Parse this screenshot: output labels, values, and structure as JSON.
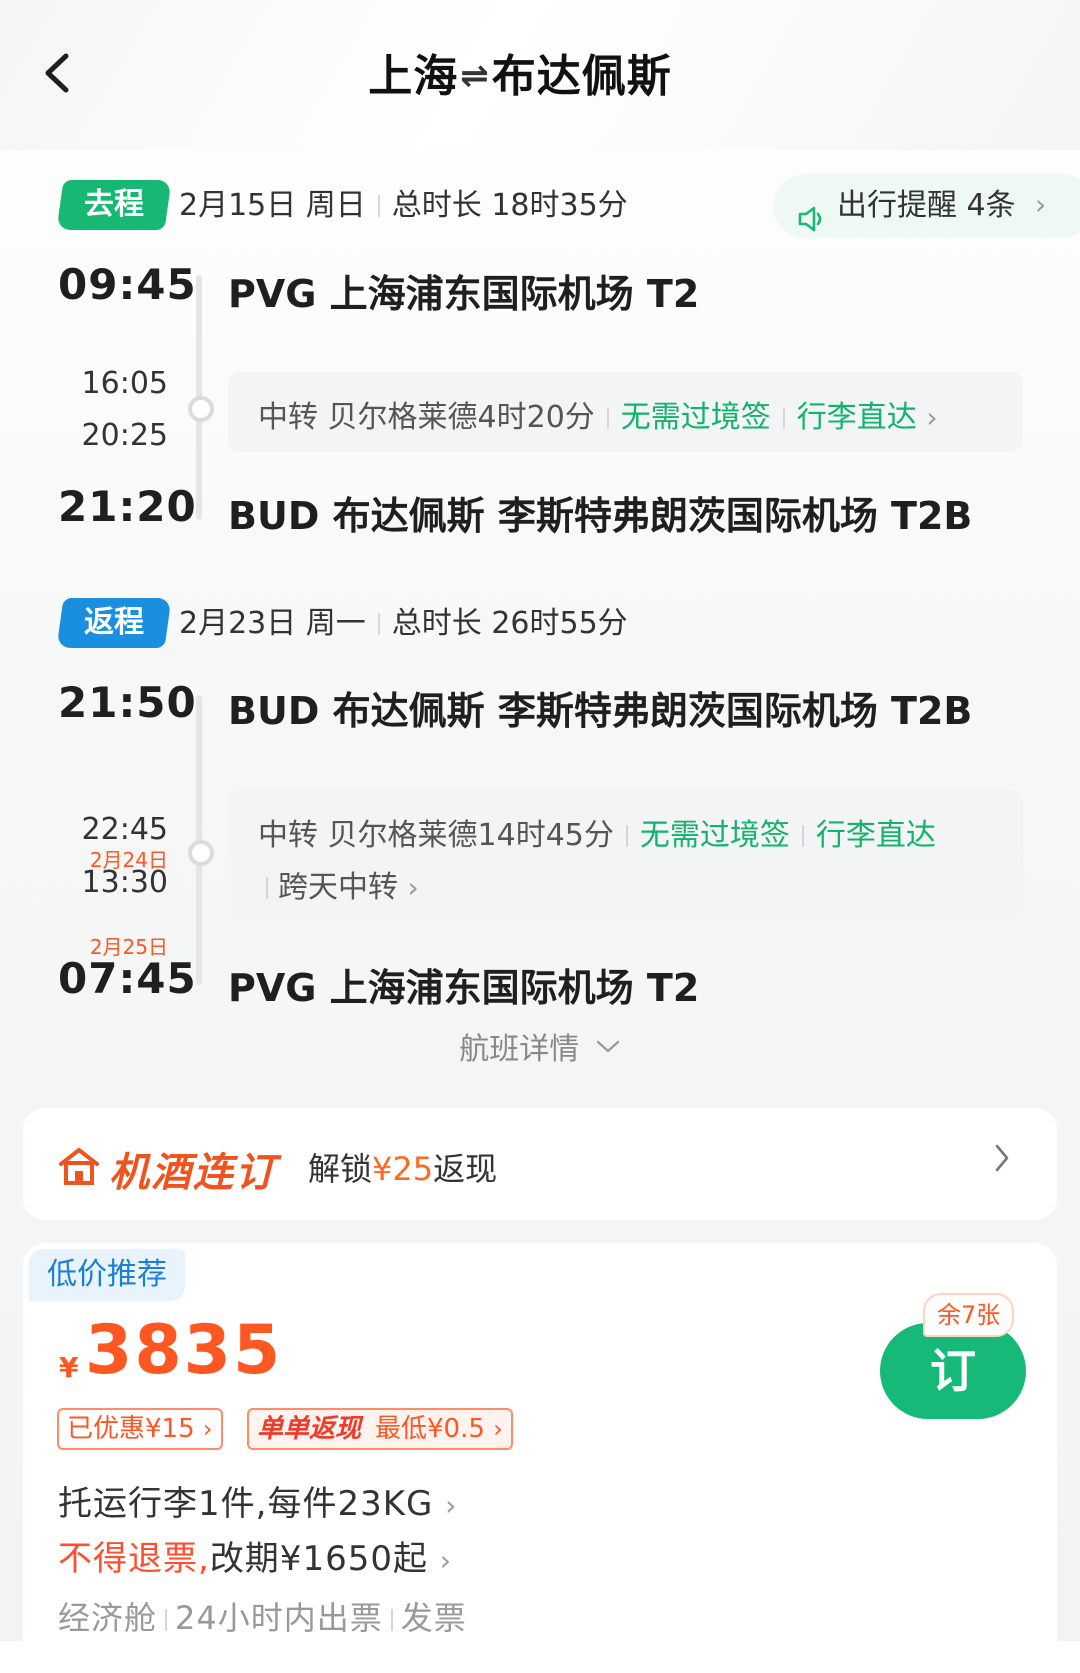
{
  "header": {
    "from_city": "上海",
    "arrows": "⇌",
    "to_city": "布达佩斯",
    "back_icon": "chevron-left-icon"
  },
  "outbound": {
    "tag": "去程",
    "date": "2月15日 周日",
    "duration": "总时长 18时35分",
    "reminder": "出行提醒 4条",
    "dep_time": "09:45",
    "dep_airport": "PVG 上海浦东国际机场 T2",
    "transfer_arrive": "16:05",
    "transfer_depart": "20:25",
    "transfer_text": "中转 贝尔格莱德4时20分",
    "no_visa": "无需过境签",
    "baggage_through": "行李直达",
    "arr_time": "21:20",
    "arr_airport": "BUD 布达佩斯 李斯特弗朗茨国际机场 T2B"
  },
  "return": {
    "tag": "返程",
    "date": "2月23日 周一",
    "duration": "总时长 26时55分",
    "dep_time": "21:50",
    "dep_airport": "BUD 布达佩斯 李斯特弗朗茨国际机场 T2B",
    "transfer_arrive": "22:45",
    "transfer_date": "2月24日",
    "transfer_depart": "13:30",
    "transfer_text": "中转 贝尔格莱德14时45分",
    "no_visa": "无需过境签",
    "baggage_through": "行李直达",
    "overnight": "跨天中转",
    "arr_date": "2月25日",
    "arr_time": "07:45",
    "arr_airport": "PVG 上海浦东国际机场 T2"
  },
  "flight_detail": "航班详情",
  "combo": {
    "title": "机酒连订",
    "text_prefix": "解锁",
    "amount": "¥25",
    "text_suffix": "返现",
    "icon": "hotel-flight-icon"
  },
  "offer": {
    "tag": "低价推荐",
    "currency": "¥",
    "price": "3835",
    "discount": "已优惠¥15",
    "cashback_label": "单单返现",
    "cashback_value": "最低¥0.5",
    "baggage": "托运行李1件,每件23KG",
    "refund_red": "不得退票,",
    "change": "改期¥1650起",
    "cabin": "经济舱",
    "issue": "24小时内出票",
    "invoice": "发票",
    "seats_left": "余7张",
    "book": "订"
  },
  "colors": {
    "green": "#16b873",
    "blue": "#1a8fe0",
    "orange": "#ff5722"
  }
}
